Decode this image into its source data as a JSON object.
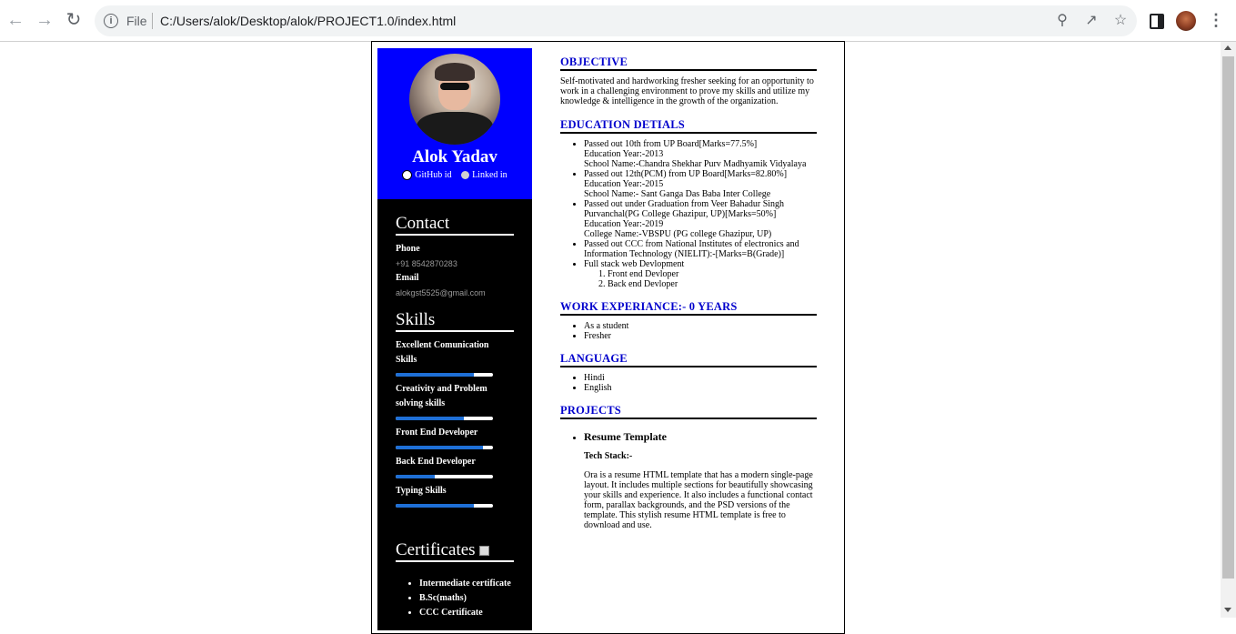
{
  "browser": {
    "file_label": "File",
    "url": "C:/Users/alok/Desktop/alok/PROJECT1.0/index.html"
  },
  "profile": {
    "name": "Alok Yadav",
    "github_label": "GitHub id",
    "linkedin_label": "Linked in"
  },
  "contact": {
    "title": "Contact",
    "phone_label": "Phone",
    "phone_value": "+91 8542870283",
    "email_label": "Email",
    "email_value": "alokgst5525@gmail.com"
  },
  "skills": {
    "title": "Skills",
    "items": [
      {
        "label": "Excellent Comunication Skills",
        "level": 0.8
      },
      {
        "label": "Creativity and Problem solving skills",
        "level": 0.7
      },
      {
        "label": "Front End Developer",
        "level": 0.9
      },
      {
        "label": "Back End Developer",
        "level": 0.4
      },
      {
        "label": "Typing Skills",
        "level": 0.8
      }
    ]
  },
  "certificates": {
    "title": "Certificates",
    "items": [
      "Intermediate certificate",
      "B.Sc(maths)",
      "CCC Certificate"
    ]
  },
  "objective": {
    "title": "OBJECTIVE",
    "text": "Self-motivated and hardworking fresher seeking for an opportunity to work in a challenging environment to prove my skills and utilize my knowledge & intelligence in the growth of the organization."
  },
  "education": {
    "title": "EDUCATION DETIALS",
    "items": [
      {
        "lines": [
          "Passed out 10th from UP Board[Marks=77.5%]",
          "Education Year:-2013",
          "School Name:-Chandra Shekhar Purv Madhyamik Vidyalaya"
        ]
      },
      {
        "lines": [
          "Passed out 12th(PCM) from UP Board[Marks=82.80%]",
          "Education Year:-2015",
          "School Name:- Sant Ganga Das Baba Inter College"
        ]
      },
      {
        "lines": [
          "Passed out under Graduation from Veer Bahadur Singh Purvanchal(PG College Ghazipur, UP)[Marks=50%]",
          "Education Year:-2019",
          "College Name:-VBSPU (PG college Ghazipur, UP)"
        ]
      },
      {
        "lines": [
          "Passed out CCC from National Institutes of electronics and Information Technology (NIELIT):-[Marks=B(Grade)]"
        ]
      },
      {
        "lines": [
          "Full stack web Devlopment"
        ],
        "sub": [
          "Front end Devloper",
          "Back end Devloper"
        ]
      }
    ]
  },
  "work": {
    "title": "WORK EXPERIANCE:- 0 YEARS",
    "items": [
      "As a student",
      "Fresher"
    ]
  },
  "language": {
    "title": "LANGUAGE",
    "items": [
      "Hindi",
      "English"
    ]
  },
  "projects": {
    "title": "PROJECTS",
    "name": "Resume Template",
    "tech_stack": "Tech Stack:-",
    "description": "Ora is a resume HTML template that has a modern single-page layout. It includes multiple sections for beautifully showcasing your skills and experience. It also includes a functional contact form, parallax backgrounds, and the PSD versions of the template. This stylish resume HTML template is free to download and use."
  }
}
